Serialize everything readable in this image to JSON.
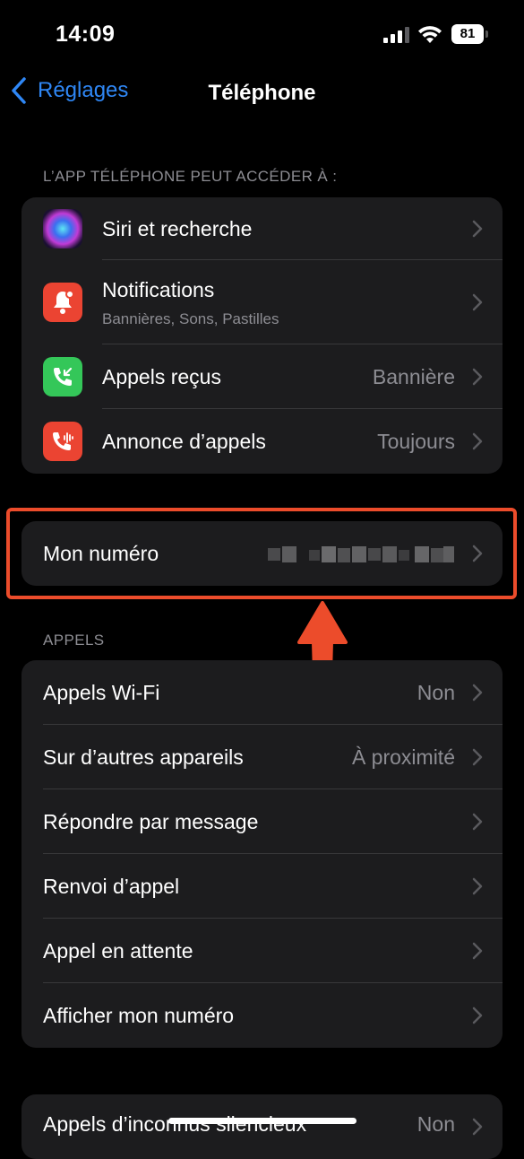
{
  "status": {
    "time": "14:09",
    "battery": "81"
  },
  "nav": {
    "back_label": "Réglages",
    "title": "Téléphone"
  },
  "section1": {
    "header": "L’APP TÉLÉPHONE PEUT ACCÉDER À :",
    "items": [
      {
        "label": "Siri et recherche",
        "icon": "siri-icon"
      },
      {
        "label": "Notifications",
        "subtitle": "Bannières, Sons, Pastilles",
        "icon": "bell-icon"
      },
      {
        "label": "Appels reçus",
        "value": "Bannière",
        "icon": "incoming-call-icon"
      },
      {
        "label": "Annonce d’appels",
        "value": "Toujours",
        "icon": "announce-call-icon"
      }
    ]
  },
  "my_number": {
    "label": "Mon numéro"
  },
  "section2": {
    "header": "APPELS",
    "items": [
      {
        "label": "Appels Wi-Fi",
        "value": "Non"
      },
      {
        "label": "Sur d’autres appareils",
        "value": "À proximité"
      },
      {
        "label": "Répondre par message"
      },
      {
        "label": "Renvoi d’appel"
      },
      {
        "label": "Appel en attente"
      },
      {
        "label": "Afficher mon numéro"
      }
    ]
  },
  "section3": {
    "items": [
      {
        "label": "Appels d’inconnus silencieux",
        "value": "Non"
      }
    ]
  },
  "colors": {
    "accent": "#2f87f5",
    "highlight": "#ec4c2b",
    "cell_bg": "#1c1c1e"
  }
}
